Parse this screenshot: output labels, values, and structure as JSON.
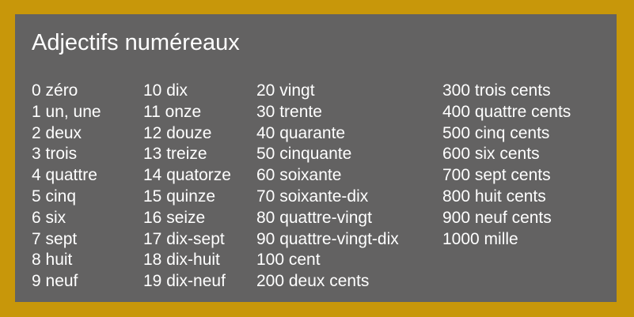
{
  "colors": {
    "frame": "#C8970A",
    "board": "#636262",
    "text": "#FFFFFF"
  },
  "title": "Adjectifs numéreaux",
  "columns": [
    [
      "0 zéro",
      "1 un, une",
      "2 deux",
      "3 trois",
      "4 quattre",
      "5 cinq",
      "6 six",
      "7 sept",
      "8 huit",
      "9 neuf"
    ],
    [
      "10 dix",
      "11 onze",
      "12 douze",
      "13 treize",
      "14 quatorze",
      "15 quinze",
      "16 seize",
      "17 dix-sept",
      "18 dix-huit",
      "19 dix-neuf"
    ],
    [
      "20 vingt",
      "30 trente",
      "40 quarante",
      "50 cinquante",
      "60 soixante",
      "70 soixante-dix",
      "80 quattre-vingt",
      "90 quattre-vingt-dix",
      "100 cent",
      "200 deux cents"
    ],
    [
      "300 trois cents",
      "400 quattre cents",
      "500 cinq cents",
      "600 six cents",
      "700 sept cents",
      "800 huit cents",
      "900 neuf cents",
      "1000 mille"
    ]
  ]
}
